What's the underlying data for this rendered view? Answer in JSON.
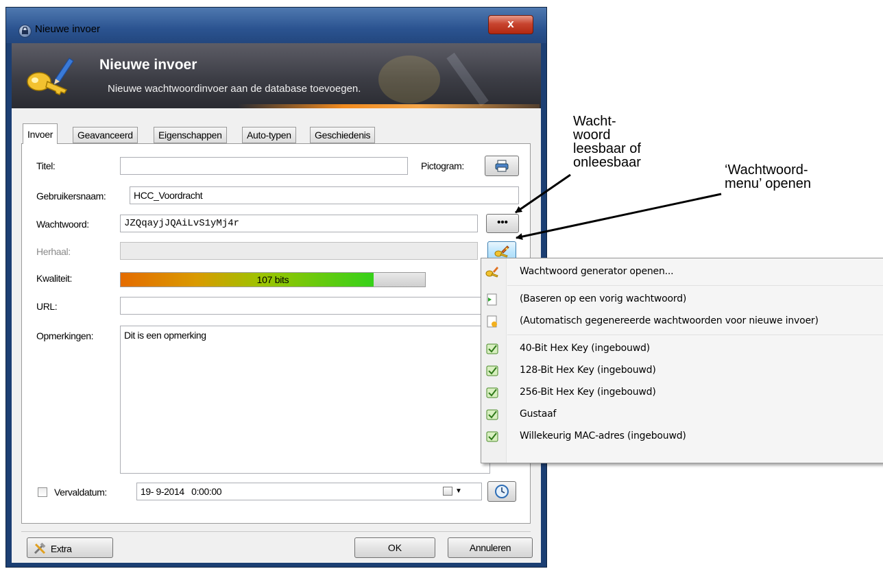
{
  "window": {
    "title": "Nieuwe invoer",
    "close_label": "x"
  },
  "banner": {
    "title": "Nieuwe invoer",
    "subtitle": "Nieuwe wachtwoordinvoer aan de database toevoegen."
  },
  "tabs": [
    "Invoer",
    "Geavanceerd",
    "Eigenschappen",
    "Auto-typen",
    "Geschiedenis"
  ],
  "form": {
    "title_label": "Titel:",
    "title_value": "",
    "icon_label": "Pictogram:",
    "username_label": "Gebruikersnaam:",
    "username_value": "HCC_Voordracht",
    "password_label": "Wachtwoord:",
    "password_value": "JZQqayjJQAiLvS1yMj4r",
    "show_password_label": "•••",
    "repeat_label": "Herhaal:",
    "repeat_value": "",
    "quality_label": "Kwaliteit:",
    "quality_text": "107 bits",
    "quality_fraction": 0.83,
    "url_label": "URL:",
    "url_value": "",
    "notes_label": "Opmerkingen:",
    "notes_value": "Dit is een opmerking",
    "expiry_label": "Vervaldatum:",
    "expiry_value": "19- 9-2014   0:00:00",
    "expiry_checked": false
  },
  "footer": {
    "extra_label": "Extra",
    "ok_label": "OK",
    "cancel_label": "Annuleren"
  },
  "menu": {
    "items": [
      {
        "label": "Wachtwoord generator openen...",
        "icon": "key-wand-icon"
      },
      {
        "label": "(Baseren op een vorig wachtwoord)",
        "icon": "document-arrow-icon"
      },
      {
        "label": "(Automatisch gegenereerde wachtwoorden voor nieuwe invoer)",
        "icon": "document-star-icon"
      },
      {
        "label": "40-Bit Hex Key (ingebouwd)",
        "icon": "profile-icon"
      },
      {
        "label": "128-Bit Hex Key (ingebouwd)",
        "icon": "profile-icon"
      },
      {
        "label": "256-Bit Hex Key (ingebouwd)",
        "icon": "profile-icon"
      },
      {
        "label": "Gustaaf",
        "icon": "profile-icon"
      },
      {
        "label": "Willekeurig MAC-adres (ingebouwd)",
        "icon": "profile-icon"
      }
    ]
  },
  "annotations": {
    "toggle_line1": "Wacht-",
    "toggle_line2": "woord",
    "toggle_line3": "leesbaar of",
    "toggle_line4": "onleesbaar",
    "menu_line1": "‘Wachtwoord-",
    "menu_line2": "menu’ openen"
  },
  "colors": {
    "titlebar": "#2b5390",
    "banner": "#3c3d45",
    "close_button": "#c8442f",
    "quality_start": "#e46c00",
    "quality_end": "#36d11a"
  }
}
